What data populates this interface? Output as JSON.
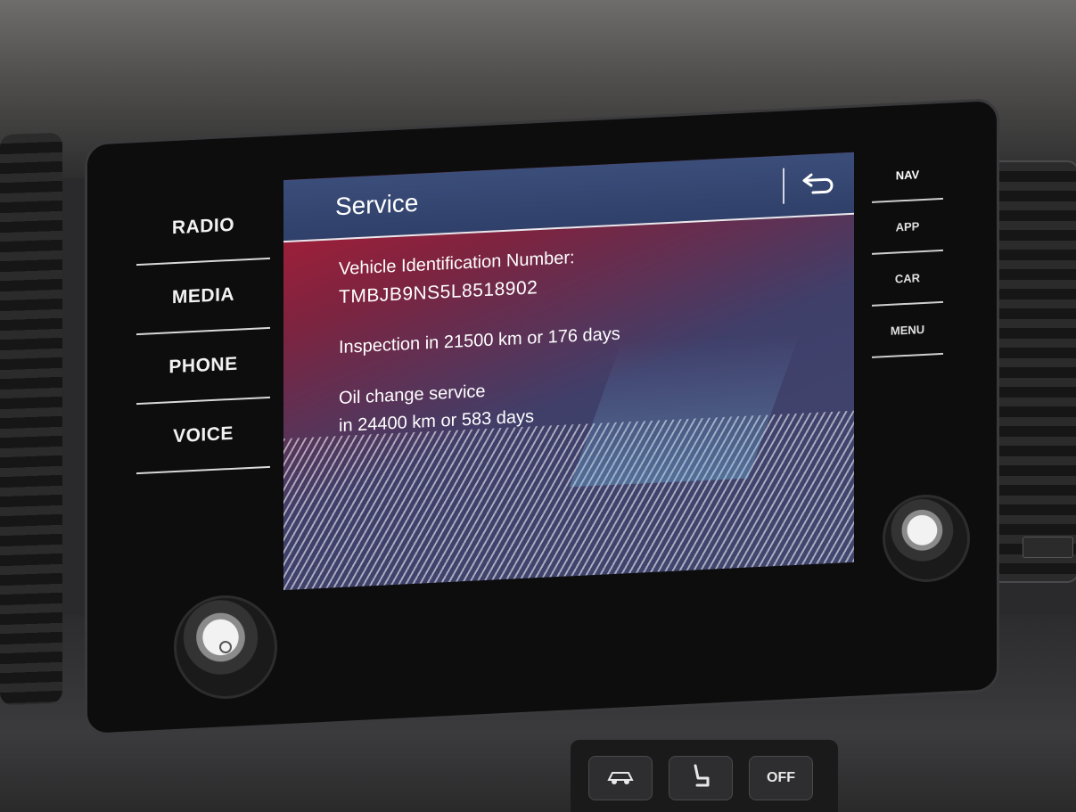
{
  "left_menu": {
    "items": [
      {
        "label": "RADIO"
      },
      {
        "label": "MEDIA"
      },
      {
        "label": "PHONE"
      },
      {
        "label": "VOICE"
      }
    ]
  },
  "right_menu": {
    "items": [
      {
        "label": "NAV"
      },
      {
        "label": "APP"
      },
      {
        "label": "CAR"
      },
      {
        "label": "MENU"
      }
    ]
  },
  "header": {
    "title": "Service",
    "back_icon": "back-arrow-icon"
  },
  "content": {
    "vin_label": "Vehicle Identification Number:",
    "vin_value": "TMBJB9NS5L8518902",
    "inspection": "Inspection in 21500 km or 176 days",
    "oil_line1": "Oil change service",
    "oil_line2": "in 24400 km or 583 days"
  },
  "console": {
    "button_off_label": "OFF"
  },
  "colors": {
    "accent_red": "#b21c35",
    "header_blue": "#2f406a",
    "text": "#ffffff"
  }
}
